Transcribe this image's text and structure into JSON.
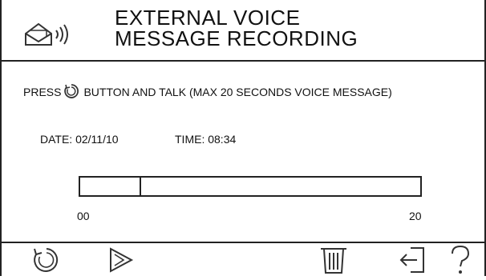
{
  "header": {
    "title_line1": "EXTERNAL VOICE",
    "title_line2": "MESSAGE RECORDING",
    "icon": "envelope-speaker-icon"
  },
  "instructions": {
    "prefix": "PRESS",
    "icon": "record-refresh-icon",
    "suffix": "BUTTON AND TALK (MAX 20 SECONDS VOICE MESSAGE)"
  },
  "meta": {
    "date_label": "DATE:",
    "date_value": "02/11/10",
    "time_label": "TIME:",
    "time_value": "08:34"
  },
  "progress": {
    "start_label": "00",
    "end_label": "20",
    "fraction": 0.18
  },
  "footer": {
    "buttons": [
      "record-icon",
      "play-icon",
      "trash-icon",
      "exit-icon",
      "help-icon"
    ]
  },
  "colors": {
    "foreground": "#222222",
    "background": "#ffffff"
  }
}
